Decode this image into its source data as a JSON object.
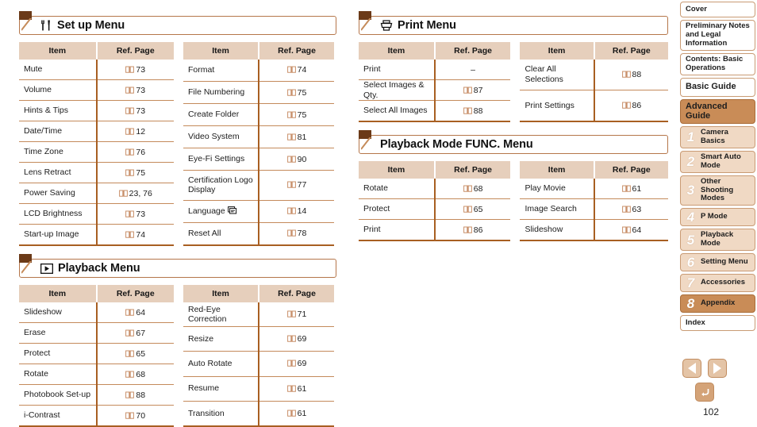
{
  "page": {
    "number": "102"
  },
  "colors": {
    "header_bg": "#e6cfbc",
    "rule": "#c48a5b",
    "rule_strong": "#a85f22",
    "accent": "#c98c57",
    "sidebar_bg": "#f0d9c4",
    "flag": "#6b3a18"
  },
  "table_headers": {
    "item": "Item",
    "ref": "Ref. Page"
  },
  "sections": [
    {
      "id": "set-up-menu",
      "title": "Set up Menu",
      "icon": "settings-fork-knife-icon",
      "left_rows": [
        {
          "item": "Mute",
          "ref": "73",
          "book": true
        },
        {
          "item": "Volume",
          "ref": "73",
          "book": true
        },
        {
          "item": "Hints & Tips",
          "ref": "73",
          "book": true
        },
        {
          "item": "Date/Time",
          "ref": "12",
          "book": true
        },
        {
          "item": "Time Zone",
          "ref": "76",
          "book": true
        },
        {
          "item": "Lens Retract",
          "ref": "75",
          "book": true
        },
        {
          "item": "Power Saving",
          "ref": "23, 76",
          "book": true
        },
        {
          "item": "LCD Brightness",
          "ref": "73",
          "book": true
        },
        {
          "item": "Start-up Image",
          "ref": "74",
          "book": true
        }
      ],
      "right_rows": [
        {
          "item": "Format",
          "ref": "74",
          "book": true
        },
        {
          "item": "File Numbering",
          "ref": "75",
          "book": true
        },
        {
          "item": "Create Folder",
          "ref": "75",
          "book": true
        },
        {
          "item": "Video System",
          "ref": "81",
          "book": true
        },
        {
          "item": "Eye-Fi Settings",
          "ref": "90",
          "book": true
        },
        {
          "item": "Certification Logo Display",
          "ref": "77",
          "book": true,
          "tall": true
        },
        {
          "item": "Language",
          "ref": "14",
          "book": true,
          "lang_icon": true
        },
        {
          "item": "Reset All",
          "ref": "78",
          "book": true
        }
      ]
    },
    {
      "id": "playback-menu",
      "title": "Playback Menu",
      "icon": "play-button-icon",
      "left_rows": [
        {
          "item": "Slideshow",
          "ref": "64",
          "book": true
        },
        {
          "item": "Erase",
          "ref": "67",
          "book": true
        },
        {
          "item": "Protect",
          "ref": "65",
          "book": true
        },
        {
          "item": "Rotate",
          "ref": "68",
          "book": true
        },
        {
          "item": "Photobook Set-up",
          "ref": "88",
          "book": true
        },
        {
          "item": "i-Contrast",
          "ref": "70",
          "book": true
        }
      ],
      "right_rows": [
        {
          "item": "Red-Eye Correction",
          "ref": "71",
          "book": true
        },
        {
          "item": "Resize",
          "ref": "69",
          "book": true
        },
        {
          "item": "Auto Rotate",
          "ref": "69",
          "book": true
        },
        {
          "item": "Resume",
          "ref": "61",
          "book": true
        },
        {
          "item": "Transition",
          "ref": "61",
          "book": true
        }
      ]
    },
    {
      "id": "print-menu",
      "title": "Print Menu",
      "icon": "printer-icon",
      "left_rows": [
        {
          "item": "Print",
          "ref": "–",
          "book": false
        },
        {
          "item": "Select Images & Qty.",
          "ref": "87",
          "book": true
        },
        {
          "item": "Select All Images",
          "ref": "88",
          "book": true
        }
      ],
      "right_rows": [
        {
          "item": "Clear All Selections",
          "ref": "88",
          "book": true
        },
        {
          "item": "Print Settings",
          "ref": "86",
          "book": true
        }
      ]
    },
    {
      "id": "playback-mode-func-menu",
      "title": "Playback Mode FUNC. Menu",
      "icon": "none",
      "left_rows": [
        {
          "item": "Rotate",
          "ref": "68",
          "book": true
        },
        {
          "item": "Protect",
          "ref": "65",
          "book": true
        },
        {
          "item": "Print",
          "ref": "86",
          "book": true
        }
      ],
      "right_rows": [
        {
          "item": "Play Movie",
          "ref": "61",
          "book": true
        },
        {
          "item": "Image Search",
          "ref": "63",
          "book": true
        },
        {
          "item": "Slideshow",
          "ref": "64",
          "book": true
        }
      ]
    }
  ],
  "sidebar": {
    "items": [
      {
        "label": "Cover",
        "num": "",
        "style": "plain"
      },
      {
        "label": "Preliminary Notes and Legal Information",
        "num": "",
        "style": "plain"
      },
      {
        "label": "Contents: Basic Operations",
        "num": "",
        "style": "plain"
      },
      {
        "label": "Basic Guide",
        "num": "",
        "style": "plain-big"
      },
      {
        "label": "Advanced Guide",
        "num": "",
        "style": "highlight-big"
      },
      {
        "label": "Camera Basics",
        "num": "1",
        "style": "numbered"
      },
      {
        "label": "Smart Auto Mode",
        "num": "2",
        "style": "numbered"
      },
      {
        "label": "Other Shooting Modes",
        "num": "3",
        "style": "numbered"
      },
      {
        "label": "P Mode",
        "num": "4",
        "style": "numbered"
      },
      {
        "label": "Playback Mode",
        "num": "5",
        "style": "numbered"
      },
      {
        "label": "Setting Menu",
        "num": "6",
        "style": "numbered"
      },
      {
        "label": "Accessories",
        "num": "7",
        "style": "numbered"
      },
      {
        "label": "Appendix",
        "num": "8",
        "style": "numbered-highlight"
      },
      {
        "label": "Index",
        "num": "",
        "style": "plain"
      }
    ]
  },
  "nav": {
    "prev": "previous-page-button",
    "next": "next-page-button",
    "back": "return-button"
  }
}
